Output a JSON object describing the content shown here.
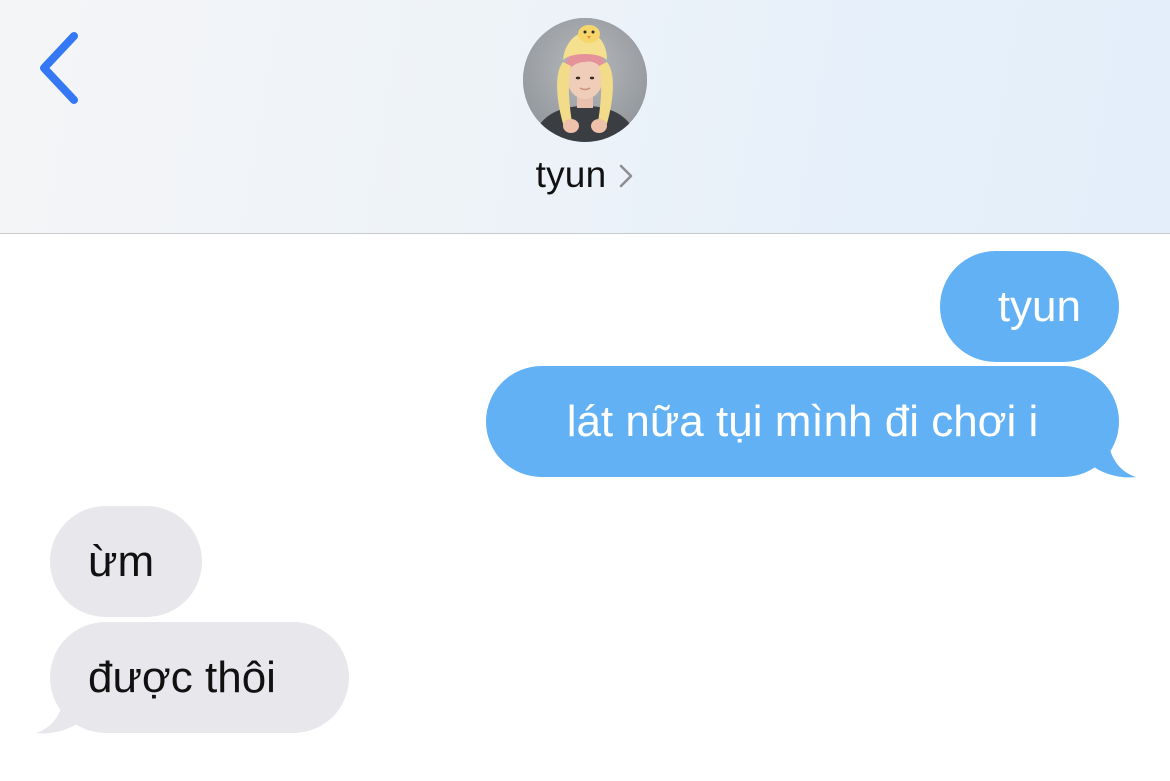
{
  "header": {
    "back_icon": "chevron-left-icon",
    "contact_name": "tyun",
    "contact_chevron_icon": "chevron-right-icon",
    "accent_color": "#3478f6"
  },
  "messages": [
    {
      "direction": "outgoing",
      "text": "tyun"
    },
    {
      "direction": "outgoing",
      "text": "lát nữa tụi mình đi chơi i"
    },
    {
      "direction": "incoming",
      "text": "ừm"
    },
    {
      "direction": "incoming",
      "text": "được thôi"
    }
  ],
  "colors": {
    "outgoing_bubble": "#62b1f4",
    "incoming_bubble": "#e7e7ec",
    "outgoing_text": "#ffffff",
    "incoming_text": "#111111"
  }
}
